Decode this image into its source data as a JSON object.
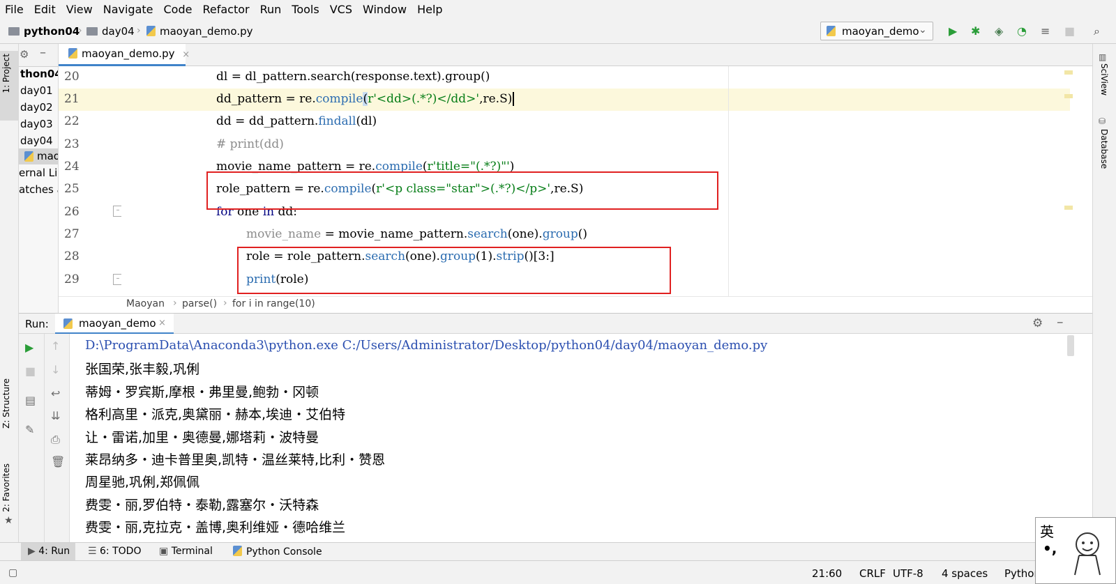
{
  "menu": [
    "File",
    "Edit",
    "View",
    "Navigate",
    "Code",
    "Refactor",
    "Run",
    "Tools",
    "VCS",
    "Window",
    "Help"
  ],
  "breadcrumb": {
    "project": "python04",
    "folder": "day04",
    "file": "maoyan_demo.py"
  },
  "run_config": "maoyan_demo",
  "left_tabs": {
    "project": "1: Project",
    "structure": "Z: Structure",
    "favorites": "2: Favorites"
  },
  "right_tabs": {
    "sciview": "SciView",
    "database": "Database"
  },
  "project_tree": [
    "thon04",
    "day01",
    "day02",
    "day03",
    "day04",
    "mao",
    "ernal Lib",
    "atches a"
  ],
  "editor_tab": "maoyan_demo.py",
  "code_lines": [
    {
      "n": "20"
    },
    {
      "n": "21"
    },
    {
      "n": "22"
    },
    {
      "n": "23"
    },
    {
      "n": "24"
    },
    {
      "n": "25"
    },
    {
      "n": "26"
    },
    {
      "n": "27"
    },
    {
      "n": "28"
    },
    {
      "n": "29"
    }
  ],
  "code": {
    "l20": "dl = dl_pattern.search(response.text).group()",
    "l21": [
      "dd_pattern = re.",
      "compile",
      "(",
      "r'<dd>(.*?)</dd>'",
      ",re.S)"
    ],
    "l22": [
      "dd = dd_pattern.",
      "findall",
      "(dl)"
    ],
    "l23": "# print(dd)",
    "l24": [
      "movie_name_pattern = re.",
      "compile",
      "(",
      "r'title=\"(.*?)\"'",
      ")"
    ],
    "l25": [
      "role_pattern = re.",
      "compile",
      "(",
      "r'<p class=\"star\">(.*?)</p>'",
      ",re.S)"
    ],
    "l26": [
      "for",
      " one ",
      "in",
      " dd:"
    ],
    "l27": [
      "movie_name",
      " = movie_name_pattern.",
      "search",
      "(one).",
      "group",
      "()"
    ],
    "l28": [
      "role = role_pattern.",
      "search",
      "(one).",
      "group",
      "(1).",
      "strip",
      "()[3:]"
    ],
    "l29": [
      "print",
      "(role)"
    ]
  },
  "editor_breadcrumb": [
    "Maoyan",
    "parse()",
    "for i in range(10)"
  ],
  "run_panel": {
    "label": "Run:",
    "tab": "maoyan_demo"
  },
  "console_lines": [
    "D:\\ProgramData\\Anaconda3\\python.exe C:/Users/Administrator/Desktop/python04/day04/maoyan_demo.py",
    "张国荣,张丰毅,巩俐",
    "蒂姆・罗宾斯,摩根・弗里曼,鲍勃・冈顿",
    "格利高里・派克,奥黛丽・赫本,埃迪・艾伯特",
    "让・雷诺,加里・奥德曼,娜塔莉・波特曼",
    "莱昂纳多・迪卡普里奥,凯特・温丝莱特,比利・赞恩",
    "周星驰,巩俐,郑佩佩",
    "费雯・丽,罗伯特・泰勒,露塞尔・沃特森",
    "费雯・丽,克拉克・盖博,奥利维娅・德哈维兰"
  ],
  "bottom_tabs": [
    "4: Run",
    "6: TODO",
    "Terminal",
    "Python Console"
  ],
  "status": {
    "position": "21:60",
    "line_sep": "CRLF",
    "encoding": "UTF-8",
    "indent": "4 spaces",
    "interpreter": "Pythor"
  },
  "ime": {
    "char": "英",
    "punct": "•,"
  },
  "colors": {
    "accent": "#4083c9",
    "highlight_line": "#fcf8dc",
    "red_box": "#e02020",
    "run_green": "#2a9d38"
  }
}
